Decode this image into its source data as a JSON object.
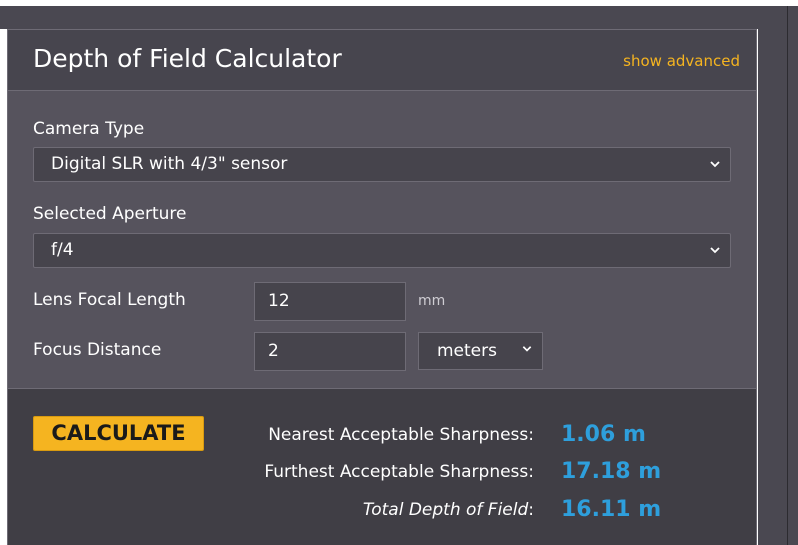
{
  "panel": {
    "title": "Depth of Field Calculator",
    "show_advanced": "show advanced"
  },
  "fields": {
    "camera_type": {
      "label": "Camera Type",
      "value": "Digital SLR with 4/3\" sensor"
    },
    "aperture": {
      "label": "Selected Aperture",
      "value": "f/4"
    },
    "focal_length": {
      "label": "Lens Focal Length",
      "value": "12",
      "unit": "mm"
    },
    "focus_distance": {
      "label": "Focus Distance",
      "value": "2",
      "unit": "meters"
    }
  },
  "actions": {
    "calculate_label": "CALCULATE"
  },
  "results": {
    "nearest": {
      "label": "Nearest Acceptable Sharpness:",
      "value": "1.06 m"
    },
    "furthest": {
      "label": "Furthest Acceptable Sharpness:",
      "value": "17.18 m"
    },
    "total": {
      "label_italic": "Total Depth of Field",
      "label_suffix": ":",
      "value": "16.11 m"
    }
  },
  "colors": {
    "accent": "#f5b420",
    "result_value": "#2e9fdc",
    "panel_bg": "#55525c",
    "header_bg": "#47454e",
    "results_bg": "#403e45"
  },
  "icons": {
    "select_chevron": "chevron-down-icon"
  }
}
